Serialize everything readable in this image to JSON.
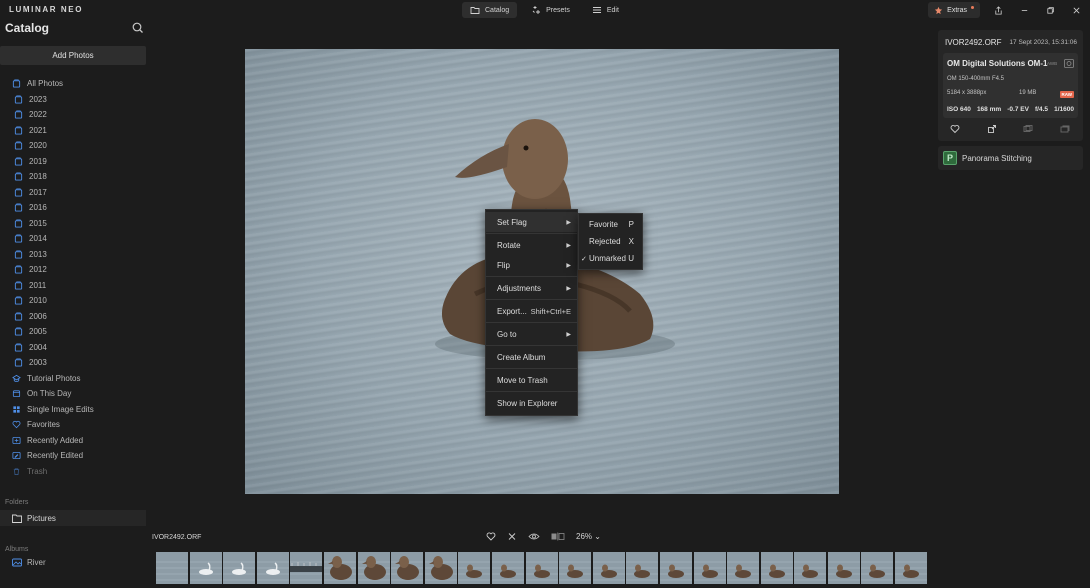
{
  "app": {
    "logo": "LUMINAR NEO"
  },
  "sidebar": {
    "title": "Catalog",
    "add_photos": "Add Photos",
    "all_photos": "All Photos",
    "years": [
      "2023",
      "2022",
      "2021",
      "2020",
      "2019",
      "2018",
      "2017",
      "2016",
      "2015",
      "2014",
      "2013",
      "2012",
      "2011",
      "2010",
      "2006",
      "2005",
      "2004",
      "2003"
    ],
    "smart": [
      {
        "label": "Tutorial Photos",
        "icon": "tutorial-icon"
      },
      {
        "label": "On This Day",
        "icon": "calendar-icon"
      },
      {
        "label": "Single Image Edits",
        "icon": "grid-icon"
      },
      {
        "label": "Favorites",
        "icon": "heart-icon"
      },
      {
        "label": "Recently Added",
        "icon": "recent-added-icon"
      },
      {
        "label": "Recently Edited",
        "icon": "recent-edited-icon"
      },
      {
        "label": "Trash",
        "icon": "trash-icon"
      }
    ],
    "folders_label": "Folders",
    "folder": "Pictures",
    "albums_label": "Albums",
    "album": "River"
  },
  "top": {
    "tabs": [
      {
        "label": "Catalog",
        "icon": "folder-icon",
        "active": true
      },
      {
        "label": "Presets",
        "icon": "sparkle-icon",
        "active": false
      },
      {
        "label": "Edit",
        "icon": "sliders-icon",
        "active": false
      }
    ],
    "extras": "Extras"
  },
  "context_menu": {
    "items": [
      {
        "label": "Set Flag",
        "submenu": true,
        "shortcut": "",
        "highlight": true
      },
      {
        "sep": true
      },
      {
        "label": "Rotate",
        "submenu": true,
        "shortcut": ""
      },
      {
        "label": "Flip",
        "submenu": true,
        "shortcut": ""
      },
      {
        "sep": true
      },
      {
        "label": "Adjustments",
        "submenu": true,
        "shortcut": ""
      },
      {
        "sep": true
      },
      {
        "label": "Export...",
        "submenu": false,
        "shortcut": "Shift+Ctrl+E"
      },
      {
        "sep": true
      },
      {
        "label": "Go to",
        "submenu": true,
        "shortcut": ""
      },
      {
        "sep": true
      },
      {
        "label": "Create Album",
        "submenu": false,
        "shortcut": ""
      },
      {
        "sep": true
      },
      {
        "label": "Move to Trash",
        "submenu": false,
        "shortcut": ""
      },
      {
        "sep": true
      },
      {
        "label": "Show in Explorer",
        "submenu": false,
        "shortcut": ""
      }
    ],
    "submenu": [
      {
        "label": "Favorite",
        "key": "P",
        "checked": false
      },
      {
        "label": "Rejected",
        "key": "X",
        "checked": false
      },
      {
        "label": "Unmarked",
        "key": "U",
        "checked": true
      }
    ]
  },
  "info": {
    "filename": "IVOR2492.ORF",
    "date": "17 Sept 2023, 15:31:06",
    "camera": "OM Digital Solutions OM-1",
    "awb": "AWB",
    "lens": "OM 150-400mm F4.5",
    "dimensions": "5184 x 3888px",
    "filesize": "19 MB",
    "raw": "RAW",
    "exif": [
      "ISO 640",
      "168 mm",
      "-0.7 EV",
      "f/4.5",
      "1/1600"
    ]
  },
  "extras_panel": {
    "panorama": "Panorama Stitching"
  },
  "bottom": {
    "current_file": "IVOR2492.ORF",
    "zoom": "26%"
  },
  "filmstrip": {
    "thumbs": [
      {
        "kind": "water"
      },
      {
        "kind": "swan"
      },
      {
        "kind": "swan"
      },
      {
        "kind": "swan"
      },
      {
        "kind": "boats"
      },
      {
        "kind": "duck-close"
      },
      {
        "kind": "duck-close"
      },
      {
        "kind": "duck-close"
      },
      {
        "kind": "duck-close"
      },
      {
        "kind": "duck"
      },
      {
        "kind": "duck"
      },
      {
        "kind": "duck"
      },
      {
        "kind": "duck"
      },
      {
        "kind": "duck"
      },
      {
        "kind": "duck"
      },
      {
        "kind": "duck"
      },
      {
        "kind": "duck"
      },
      {
        "kind": "duck"
      },
      {
        "kind": "duck"
      },
      {
        "kind": "duck"
      },
      {
        "kind": "duck"
      },
      {
        "kind": "duck"
      },
      {
        "kind": "duck"
      },
      {
        "kind": "duck"
      },
      {
        "kind": "duck"
      }
    ]
  }
}
